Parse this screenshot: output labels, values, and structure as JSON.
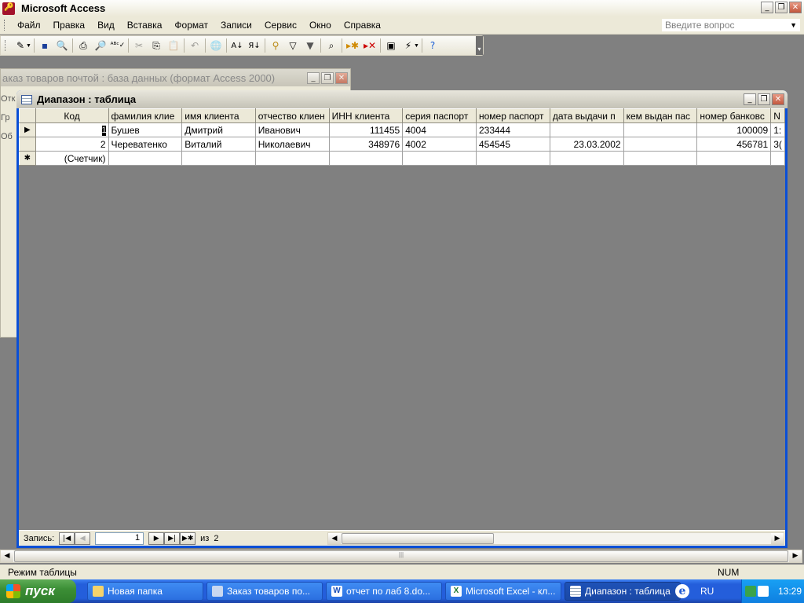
{
  "app": {
    "title": "Microsoft Access"
  },
  "window_controls": {
    "minimize": "_",
    "restore": "❐",
    "close": "✕"
  },
  "menu": {
    "items": [
      {
        "label": "Файл"
      },
      {
        "label": "Правка"
      },
      {
        "label": "Вид"
      },
      {
        "label": "Вставка"
      },
      {
        "label": "Формат"
      },
      {
        "label": "Записи"
      },
      {
        "label": "Сервис"
      },
      {
        "label": "Окно"
      },
      {
        "label": "Справка"
      }
    ],
    "ask_placeholder": "Введите вопрос"
  },
  "toolbar": {
    "icons": [
      "view-icon",
      "save-icon",
      "file-search-icon",
      "print-icon",
      "print-preview-icon",
      "spelling-icon",
      "cut-icon",
      "copy-icon",
      "paste-icon",
      "undo-icon",
      "hyperlink-icon",
      "sort-ascending-icon",
      "sort-descending-icon",
      "filter-by-selection-icon",
      "filter-by-form-icon",
      "apply-filter-icon",
      "find-icon",
      "new-record-icon",
      "delete-record-icon",
      "database-window-icon",
      "new-object-icon",
      "help-icon"
    ]
  },
  "db_window": {
    "title": "аказ товаров почтой : база данных (формат Access 2000)",
    "side_labels": [
      "Отк",
      "Гр",
      "Об"
    ]
  },
  "table_window": {
    "title": "Диапазон : таблица"
  },
  "datasheet": {
    "columns": [
      {
        "label": "Код"
      },
      {
        "label": "фамилия  клие"
      },
      {
        "label": " имя  клиента"
      },
      {
        "label": "отчество  клиен"
      },
      {
        "label": " ИНН  клиента"
      },
      {
        "label": "серия  паспорт"
      },
      {
        "label": "номер паспорт"
      },
      {
        "label": "дата  выдачи п"
      },
      {
        "label": "кем выдан  пас"
      },
      {
        "label": "номер банковс"
      },
      {
        "label": "N"
      }
    ],
    "rows": [
      {
        "selector": "▶",
        "cells": [
          "1",
          "Бушев",
          "Дмитрий",
          "Иванович",
          "111455",
          "4004",
          "233444",
          "",
          "",
          "100009",
          "1:"
        ]
      },
      {
        "selector": "",
        "cells": [
          "2",
          "Череватенко",
          "Виталий",
          "Николаевич",
          "348976",
          "4002",
          "454545",
          "23.03.2002",
          "",
          "456781",
          "3("
        ]
      },
      {
        "selector": "✱",
        "cells": [
          "(Счетчик)",
          "",
          "",
          "",
          "",
          "",
          "",
          "",
          "",
          "",
          ""
        ]
      }
    ]
  },
  "record_nav": {
    "label": "Запись:",
    "current": "1",
    "of_label": "из",
    "total": "2"
  },
  "statusbar": {
    "mode": "Режим таблицы",
    "num": "NUM"
  },
  "taskbar": {
    "start_label": "пуск",
    "tasks": [
      {
        "label": "Новая папка",
        "icon": "folder-icon",
        "active": false
      },
      {
        "label": "Заказ товаров по...",
        "icon": "access-db-icon",
        "active": false
      },
      {
        "label": "отчет по лаб 8.do...",
        "icon": "word-doc-icon",
        "active": false
      },
      {
        "label": "Microsoft Excel - кл...",
        "icon": "excel-icon",
        "active": false
      },
      {
        "label": "Диапазон : таблица",
        "icon": "table-icon",
        "active": true
      }
    ],
    "language": "RU",
    "time": "13:29"
  }
}
